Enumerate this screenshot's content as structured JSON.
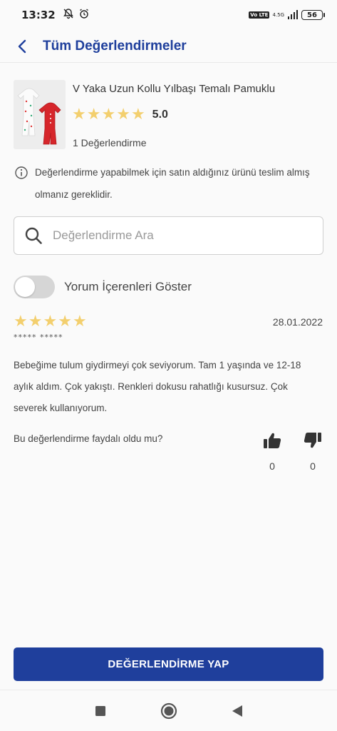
{
  "status_bar": {
    "time": "13:32",
    "network_label": "4.5G",
    "lte_badge": "Vo LTE",
    "battery": "56"
  },
  "header": {
    "title": "Tüm Değerlendirmeler"
  },
  "product": {
    "name": "V Yaka Uzun Kollu Yılbaşı Temalı Pamuklu",
    "rating": "5.0",
    "review_count": "1 Değerlendirme",
    "star_color": "#f3cf6e"
  },
  "info": {
    "text": "Değerlendirme yapabilmek için satın aldığınız ürünü teslim almış olmanız gereklidir."
  },
  "search": {
    "placeholder": "Değerlendirme Ara"
  },
  "filter": {
    "toggle_label": "Yorum İçerenleri Göster",
    "toggle_on": false
  },
  "review": {
    "date": "28.01.2022",
    "reviewer": "***** *****",
    "text": "Bebeğime tulum  giydirmeyi çok seviyorum. Tam 1 yaşında ve 12-18 aylık aldım. Çok yakıştı. Renkleri dokusu rahatlığı kusursuz. Çok severek kullanıyorum.",
    "helpful_question": "Bu değerlendirme faydalı oldu mu?",
    "likes": "0",
    "dislikes": "0"
  },
  "cta": {
    "label": "DEĞERLENDİRME YAP",
    "color": "#1f3f9c"
  }
}
